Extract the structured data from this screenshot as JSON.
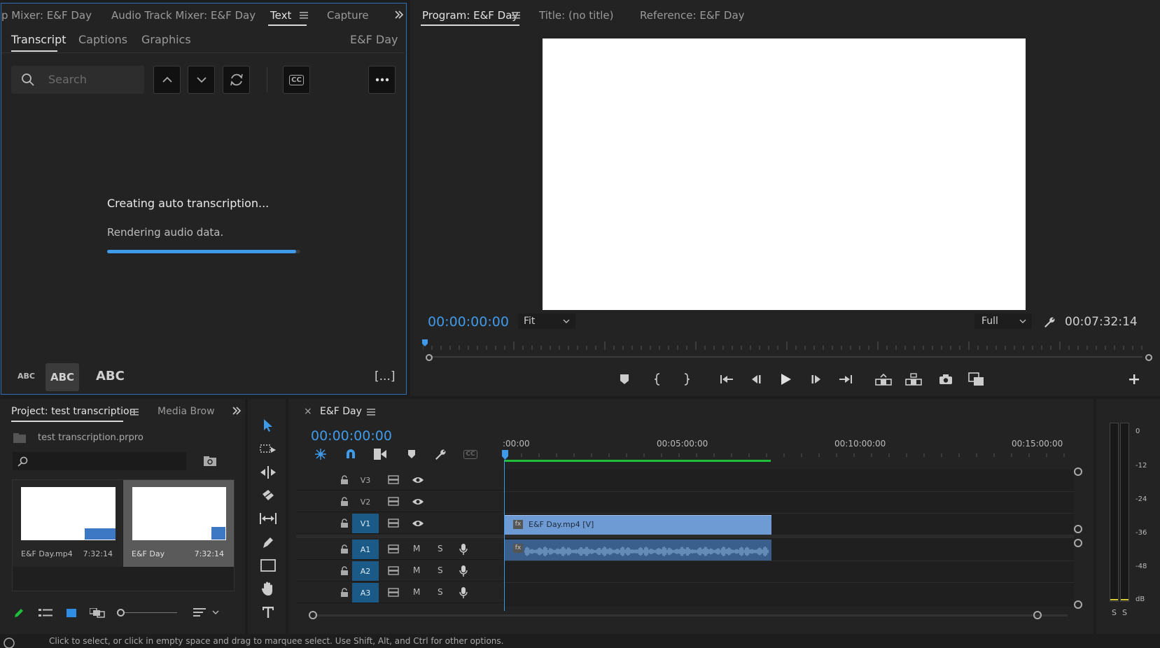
{
  "top_left_tabs": [
    {
      "label": "p Mixer: E&F Day"
    },
    {
      "label": "Audio Track Mixer: E&F Day"
    },
    {
      "label": "Text"
    },
    {
      "label": "Capture"
    }
  ],
  "text_panel": {
    "subtabs": [
      "Transcript",
      "Captions",
      "Graphics"
    ],
    "sequence_name": "E&F Day",
    "search_placeholder": "Search",
    "status_title": "Creating auto transcription...",
    "status_detail": "Rendering audio data.",
    "progress_fraction": 0.98,
    "font_sizes": [
      "ABC",
      "ABC",
      "ABC"
    ],
    "cc_label": "CC",
    "bracket_label": "[...]"
  },
  "monitor_tabs": [
    {
      "label": "Program: E&F Day"
    },
    {
      "label": "Title: (no title)"
    },
    {
      "label": "Reference: E&F Day"
    }
  ],
  "program": {
    "current_time": "00:00:00:00",
    "zoom": "Fit",
    "quality": "Full",
    "duration": "00:07:32:14"
  },
  "project": {
    "tabs": [
      "Project: test transcription",
      "Media Brow"
    ],
    "file_name": "test transcription.prpro",
    "items": [
      {
        "name": "E&F Day.mp4",
        "duration": "7:32:14"
      },
      {
        "name": "E&F Day",
        "duration": "7:32:14"
      }
    ]
  },
  "timeline": {
    "close": "×",
    "sequence_name": "E&F Day",
    "timecode": "00:00:00:00",
    "ruler": [
      ":00:00",
      "00:05:00:00",
      "00:10:00:00",
      "00:15:00:00"
    ],
    "video_tracks": [
      "V3",
      "V2",
      "V1"
    ],
    "audio_tracks": [
      "A1",
      "A2",
      "A3"
    ],
    "mute_label": "M",
    "solo_label": "S",
    "clip_label": "E&F Day.mp4 [V]",
    "fx_label": "fx"
  },
  "meter": {
    "scale": [
      "0",
      "-12",
      "-24",
      "-36",
      "-48",
      "dB"
    ],
    "solo": [
      "S",
      "S"
    ]
  },
  "status_bar": {
    "text": "Click to select, or click in empty space and drag to marquee select. Use Shift, Alt, and Ctrl for other options."
  },
  "colors": {
    "accent": "#3f9bea",
    "green": "#1fbf3c",
    "clip": "#6e9bd4"
  }
}
